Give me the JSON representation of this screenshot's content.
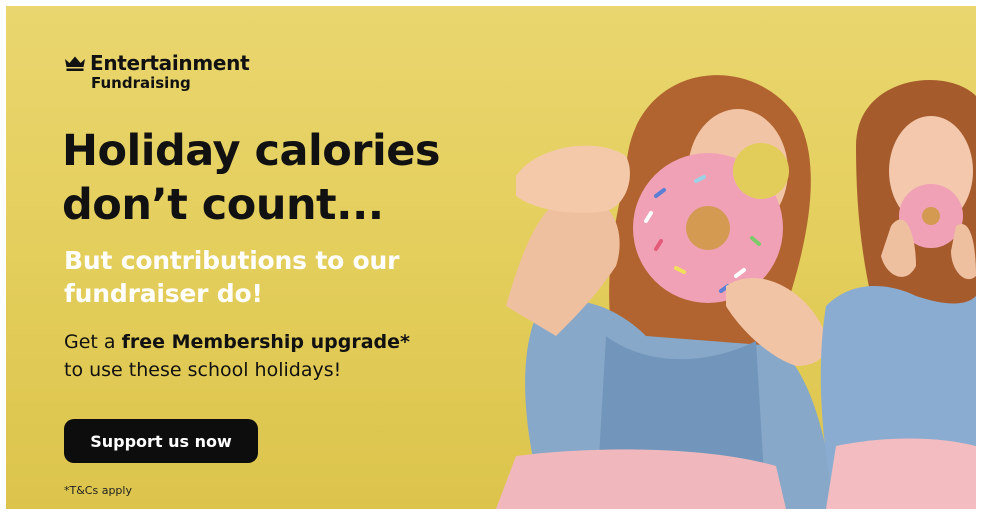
{
  "brand": {
    "icon": "crown-icon",
    "name": "Entertainment",
    "subname": "Fundraising"
  },
  "headline": {
    "line1": "Holiday calories",
    "line2": "don’t count..."
  },
  "subheadline": {
    "line1": "But contributions to our",
    "line2": "fundraiser do!"
  },
  "body": {
    "prefix": "Get a ",
    "bold": "free Membership upgrade*",
    "line2": "to use these school holidays!"
  },
  "cta": {
    "label": "Support us now"
  },
  "terms": "*T&Cs apply",
  "colors": {
    "background": "#e3cd5a",
    "button": "#0d0d0d",
    "headline": "#111111",
    "subheadline": "#ffffff"
  }
}
